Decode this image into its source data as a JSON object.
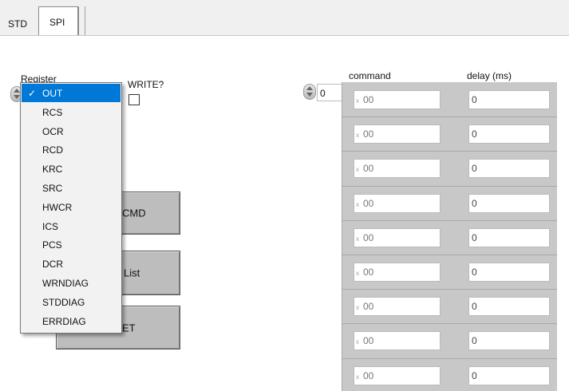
{
  "tabs": [
    {
      "label": "STD",
      "active": false
    },
    {
      "label": "SPI",
      "active": true
    }
  ],
  "register": {
    "label": "Register",
    "selected": "OUT",
    "options": [
      "OUT",
      "RCS",
      "OCR",
      "RCD",
      "KRC",
      "SRC",
      "HWCR",
      "ICS",
      "PCS",
      "DCR",
      "WRNDIAG",
      "STDDIAG",
      "ERRDIAG"
    ]
  },
  "write": {
    "label": "WRITE?",
    "checked": false
  },
  "buttons": [
    {
      "label": "CMD"
    },
    {
      "label": "List"
    },
    {
      "label": "ET"
    }
  ],
  "array": {
    "index": "0",
    "command_header": "command",
    "delay_header": "delay (ms)",
    "rows": [
      {
        "command": "00",
        "delay": "0"
      },
      {
        "command": "00",
        "delay": "0"
      },
      {
        "command": "00",
        "delay": "0"
      },
      {
        "command": "00",
        "delay": "0"
      },
      {
        "command": "00",
        "delay": "0"
      },
      {
        "command": "00",
        "delay": "0"
      },
      {
        "command": "00",
        "delay": "0"
      },
      {
        "command": "00",
        "delay": "0"
      },
      {
        "command": "00",
        "delay": "0"
      }
    ]
  },
  "colors": {
    "selection": "#0078d7",
    "panel": "#ffffff",
    "button": "#bdbdbd",
    "array_frame": "#c8c8c8"
  },
  "icons": {
    "check": "checkmark-icon",
    "spinner": "spinner-icon",
    "element_marker": "x-mark-icon"
  }
}
